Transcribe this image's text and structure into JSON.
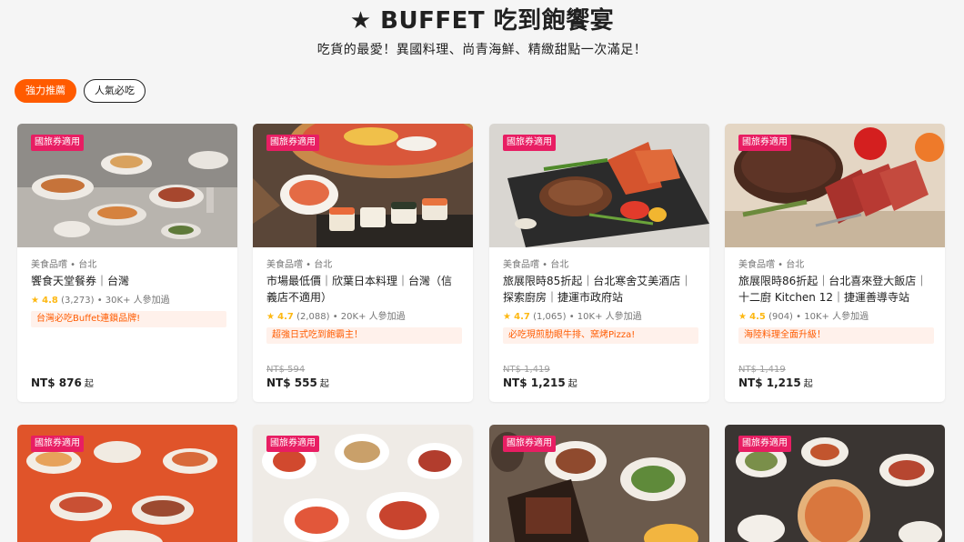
{
  "header": {
    "title": "★ BUFFET 吃到飽饗宴",
    "subtitle": "吃貨的最愛！異國料理、尚青海鮮、精緻甜點一次滿足！"
  },
  "tabs": [
    {
      "label": "強力推薦",
      "active": true
    },
    {
      "label": "人氣必吃",
      "active": false
    }
  ],
  "badge_label": "國旅券適用",
  "cards": [
    {
      "category": "美食品嚐 • 台北",
      "name": "饗食天堂餐券｜台灣",
      "rating": "4.8",
      "reviews": "(3,273)",
      "booked": "30K+ 人參加過",
      "promo": "台灣必吃Buffet連鎖品牌!",
      "old_price": "",
      "price": "NT$ 876",
      "price_suffix": "起"
    },
    {
      "category": "美食品嚐 • 台北",
      "name": "市場最低價｜欣葉日本料理｜台灣（信義店不適用）",
      "rating": "4.7",
      "reviews": "(2,088)",
      "booked": "20K+ 人參加過",
      "promo": "超強日式吃到飽霸主！",
      "old_price": "NT$ 594",
      "price": "NT$ 555",
      "price_suffix": "起"
    },
    {
      "category": "美食品嚐 • 台北",
      "name": "旅展限時85折起｜台北寒舍艾美酒店｜探索廚房｜捷運市政府站",
      "rating": "4.7",
      "reviews": "(1,065)",
      "booked": "10K+ 人參加過",
      "promo": "必吃現煎肋眼牛排、窯烤Pizza!",
      "old_price": "NT$ 1,419",
      "price": "NT$ 1,215",
      "price_suffix": "起"
    },
    {
      "category": "美食品嚐 • 台北",
      "name": "旅展限時86折起｜台北喜來登大飯店｜十二廚 Kitchen 12｜捷運善導寺站",
      "rating": "4.5",
      "reviews": "(904)",
      "booked": "10K+ 人參加過",
      "promo": "海陸料理全面升級！",
      "old_price": "NT$ 1,419",
      "price": "NT$ 1,215",
      "price_suffix": "起"
    }
  ],
  "colors": {
    "accent": "#ff5b00",
    "badge": "#e81e63",
    "star": "#fdb813",
    "promo_bg": "#fff1eb"
  }
}
